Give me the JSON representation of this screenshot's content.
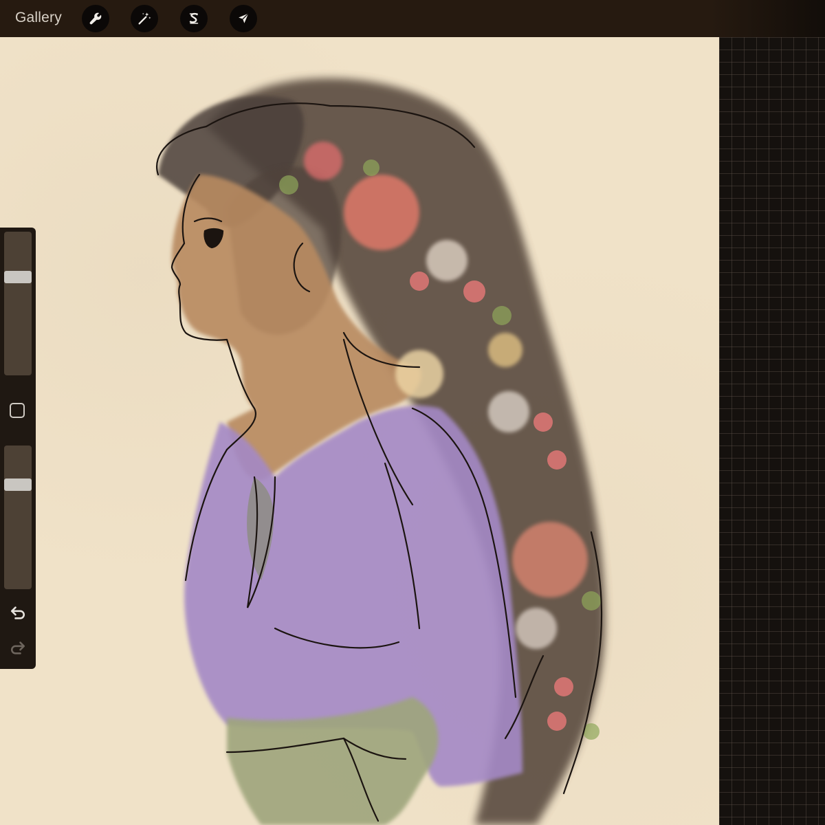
{
  "topbar": {
    "gallery_label": "Gallery",
    "tools": [
      {
        "name": "actions",
        "icon": "wrench-icon"
      },
      {
        "name": "adjustments",
        "icon": "magic-wand-icon"
      },
      {
        "name": "selection",
        "icon": "selection-s-icon"
      },
      {
        "name": "transform",
        "icon": "arrow-cursor-icon"
      }
    ]
  },
  "sidebar": {
    "brush_size_level": 0.7,
    "opacity_level": 0.75,
    "modify_icon": "square-icon",
    "undo_icon": "undo-icon",
    "redo_icon": "redo-icon"
  },
  "canvas": {
    "paper_color": "#f0e2c8",
    "artwork": "watercolor-illustration"
  },
  "colors": {
    "toolbar_bg": "#261a10",
    "sidebar_bg": "#1f1812",
    "icon_color": "#e8e4df"
  }
}
